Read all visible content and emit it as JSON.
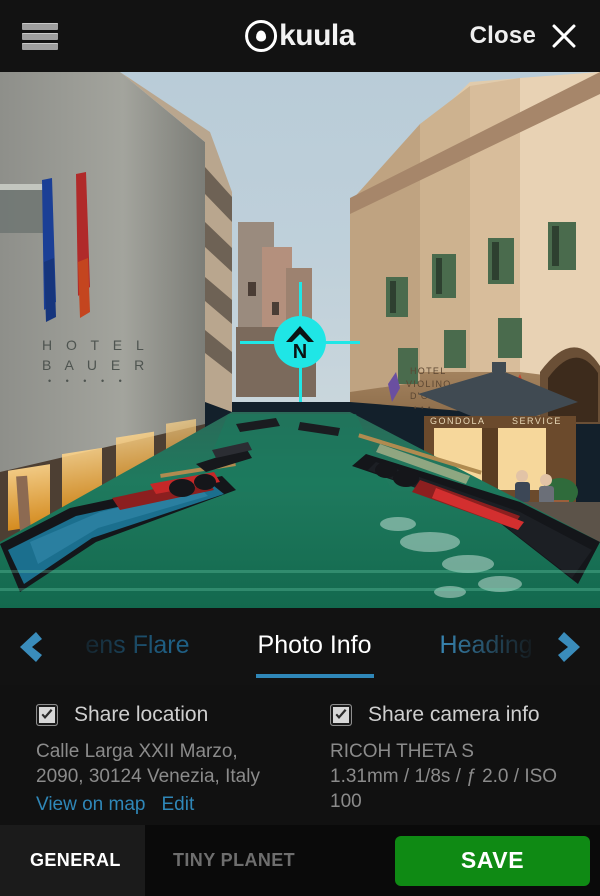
{
  "header": {
    "menu_icon": "hamburger-menu-icon",
    "brand_name": "kuula",
    "brand_mark_icon": "kuula-circle-pin-icon",
    "close_label": "Close",
    "close_icon": "close-x-icon"
  },
  "viewer": {
    "compass": {
      "icon": "north-heading-marker-icon",
      "letter": "N",
      "color": "#1fe6e6"
    },
    "scene_signs": {
      "hotel_left": "HOTEL BAUER",
      "hotel_left_stars": "• • • • •",
      "hotel_right_line1": "HOTEL",
      "hotel_right_line2": "VIOLINO",
      "hotel_right_line3": "D'ORO",
      "hotel_right_stars": "• • •",
      "kiosk_left": "GONDOLA",
      "kiosk_right": "SERVICE"
    }
  },
  "tabbar": {
    "prev_arrow_icon": "chevron-left-icon",
    "next_arrow_icon": "chevron-right-icon",
    "tabs": [
      {
        "label": "ens Flare",
        "state": "previous"
      },
      {
        "label": "Photo Info",
        "state": "active"
      },
      {
        "label": "Heading",
        "state": "next"
      }
    ],
    "accent_color": "#2f87b8"
  },
  "panel": {
    "location": {
      "checkbox_label": "Share location",
      "checked": true,
      "address_line1": "Calle Larga XXII Marzo,",
      "address_line2": "2090, 30124 Venezia, Italy",
      "link_map": "View on map",
      "link_edit": "Edit"
    },
    "camera": {
      "checkbox_label": "Share camera info",
      "checked": true,
      "model": "RICOH THETA S",
      "exposure": "1.31mm / 1/8s / ƒ 2.0 / ISO 100"
    }
  },
  "bottombar": {
    "general_label": "GENERAL",
    "tiny_planet_label": "TINY PLANET",
    "save_label": "SAVE",
    "save_color": "#0f8a14"
  }
}
